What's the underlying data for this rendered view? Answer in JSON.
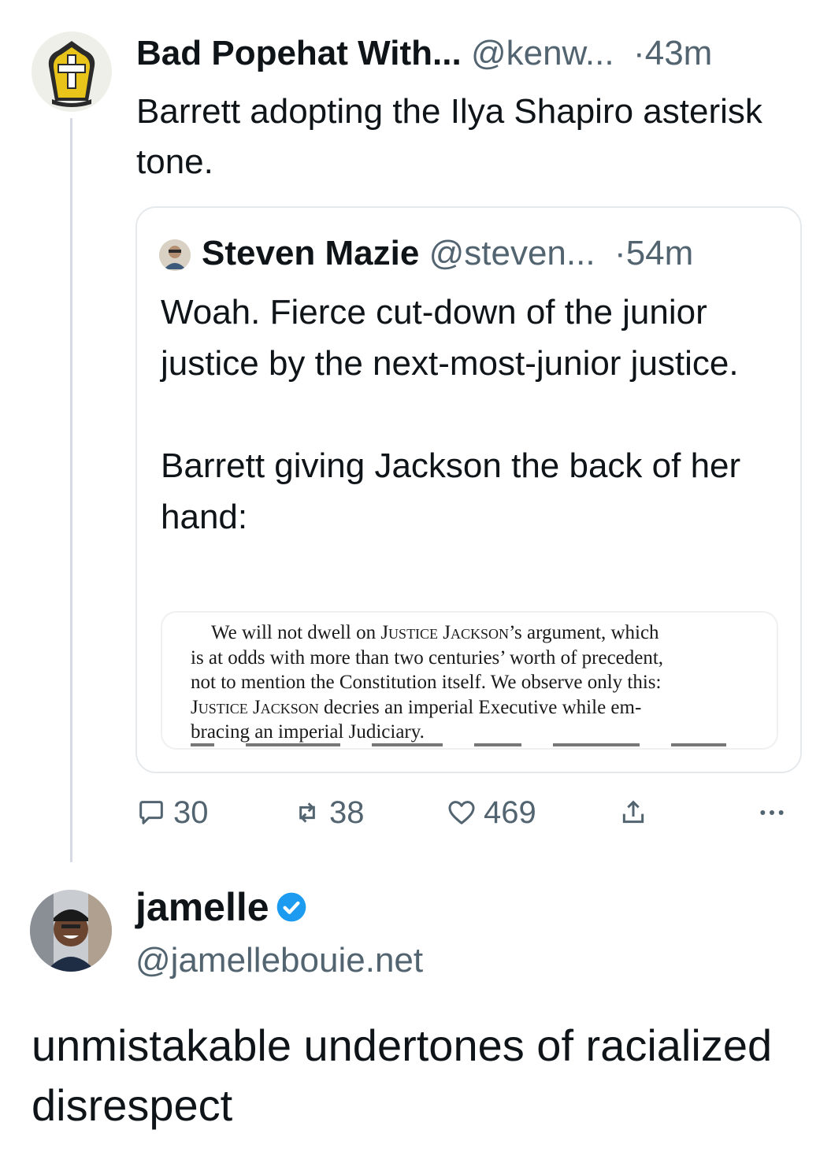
{
  "post1": {
    "display_name": "Bad Popehat With...",
    "handle": "@kenw...",
    "time": "43m",
    "text": "Barrett adopting the Ilya Shapiro asterisk tone.",
    "avatar_icon": "popehat-avatar"
  },
  "quote": {
    "display_name": "Steven Mazie",
    "handle": "@steven...",
    "time": "54m",
    "paragraph1": "Woah. Fierce cut-down of the junior justice by the next-most-junior justice.",
    "paragraph2": "Barrett giving Jackson the back of her hand:",
    "document": {
      "line1_a": "We will not dwell on ",
      "line1_sc": "Justice Jackson",
      "line1_b": "’s argument, which",
      "line2": "is at odds with more than two centuries’ worth of precedent,",
      "line3": "not to mention the Constitution itself.  We observe only this:",
      "line4_sc": "Justice Jackson",
      "line4_b": " decries an imperial Executive while em-",
      "line5": "bracing an imperial Judiciary."
    }
  },
  "actions": {
    "replies": "30",
    "reposts": "38",
    "likes": "469"
  },
  "post2": {
    "display_name": "jamelle",
    "handle": "@jamellebouie.net",
    "text": "unmistakable undertones of racialized disrespect",
    "verified_color": "#1d9bf0"
  },
  "colors": {
    "text": "#0f1419",
    "secondary": "#536471",
    "border": "#e6e9ec",
    "thread_line": "#d6dbe3"
  }
}
